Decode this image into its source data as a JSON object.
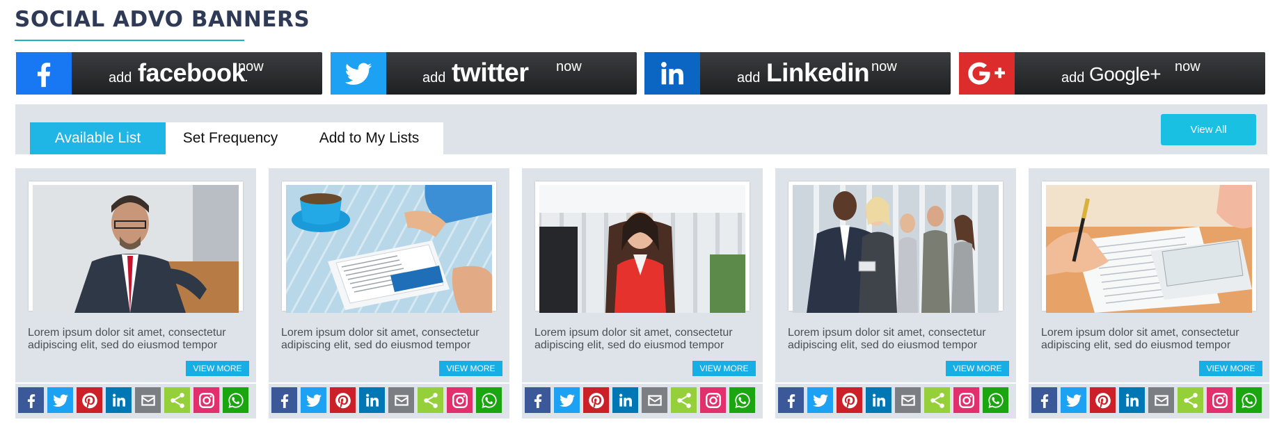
{
  "page": {
    "title": "SOCIAL ADVO BANNERS"
  },
  "banners": [
    {
      "id": "facebook",
      "add": "add",
      "brand": "facebook",
      "brand_suffix": ".",
      "now": "now",
      "color": "#1877f2",
      "icon": "facebook-icon"
    },
    {
      "id": "twitter",
      "add": "add",
      "brand": "twitter",
      "brand_suffix": "",
      "now": "now",
      "color": "#1da1f2",
      "icon": "twitter-icon"
    },
    {
      "id": "linkedin",
      "add": "add",
      "brand": "Linkedin",
      "brand_suffix": "",
      "now": "now",
      "color": "#0a66c2",
      "icon": "linkedin-icon"
    },
    {
      "id": "googleplus",
      "add": "add",
      "brand": "Google+",
      "brand_suffix": "",
      "now": "now",
      "color": "#dd2c2c",
      "icon": "google-plus-icon"
    }
  ],
  "tabs": [
    {
      "label": "Available List",
      "active": true
    },
    {
      "label": "Set Frequency",
      "active": false
    },
    {
      "label": "Add to My Lists",
      "active": false
    }
  ],
  "view_all_label": "View All",
  "cards": [
    {
      "photo": "businessman-portrait",
      "description": "Lorem ipsum dolor sit amet, consectetur adipiscing elit, sed do eiusmod tempor",
      "cta": "VIEW MORE"
    },
    {
      "photo": "tablet-coffee",
      "description": "Lorem ipsum dolor sit amet, consectetur adipiscing elit, sed do eiusmod tempor",
      "cta": "VIEW MORE"
    },
    {
      "photo": "businesswoman-red-jacket",
      "description": "Lorem ipsum dolor sit amet, consectetur adipiscing elit, sed do eiusmod tempor",
      "cta": "VIEW MORE"
    },
    {
      "photo": "business-team",
      "description": "Lorem ipsum dolor sit amet, consectetur adipiscing elit, sed do eiusmod tempor",
      "cta": "VIEW MORE"
    },
    {
      "photo": "signing-document",
      "description": "Lorem ipsum dolor sit amet, consectetur adipiscing elit, sed do eiusmod tempor",
      "cta": "VIEW MORE"
    }
  ],
  "share_buttons": [
    {
      "icon": "facebook-icon",
      "color": "#3b5998"
    },
    {
      "icon": "twitter-icon",
      "color": "#1da1f2"
    },
    {
      "icon": "pinterest-icon",
      "color": "#cb2027"
    },
    {
      "icon": "linkedin-icon",
      "color": "#0077b5"
    },
    {
      "icon": "email-icon",
      "color": "#7b7f83"
    },
    {
      "icon": "share-icon",
      "color": "#95d03a"
    },
    {
      "icon": "instagram-icon",
      "color": "#e1306c"
    },
    {
      "icon": "whatsapp-icon",
      "color": "#1ba511"
    }
  ]
}
